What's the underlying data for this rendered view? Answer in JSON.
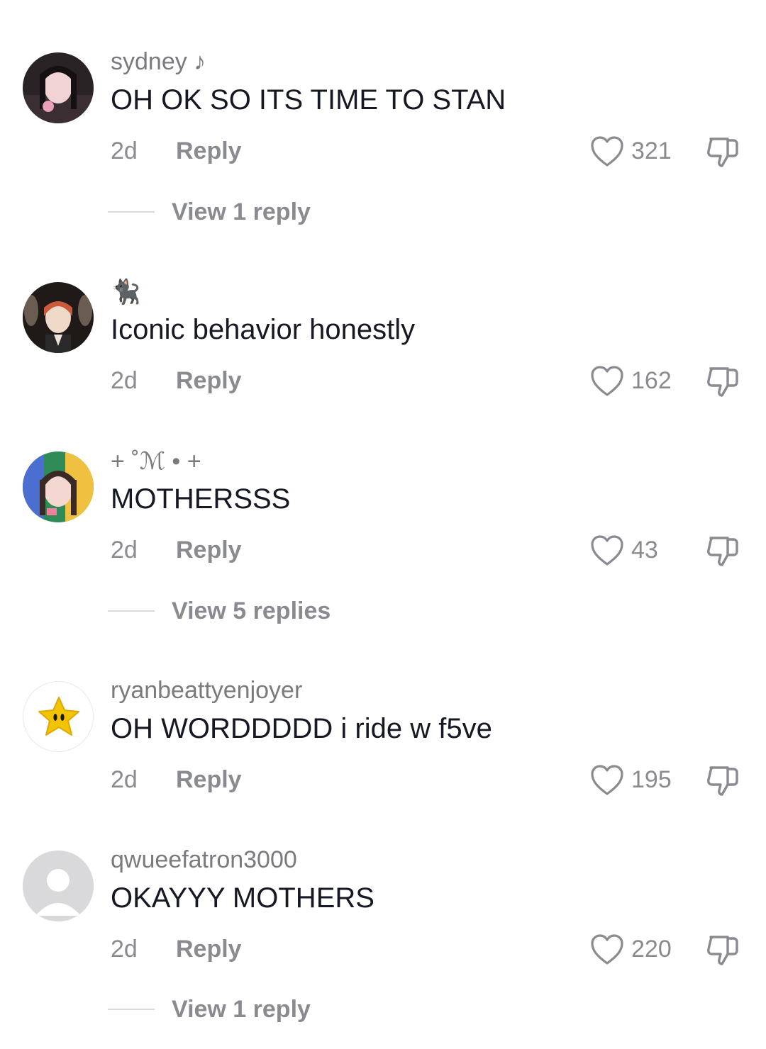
{
  "comments": [
    {
      "username": "sydney ♪",
      "text": "OH OK SO ITS TIME TO STAN",
      "time": "2d",
      "reply_label": "Reply",
      "likes": "321",
      "view_replies": "View 1 reply",
      "avatar_colors": [
        "#2a2326",
        "#e8b6c4",
        "#1b1518"
      ]
    },
    {
      "username": "🐈‍⬛",
      "text": "Iconic behavior honestly",
      "time": "2d",
      "reply_label": "Reply",
      "likes": "162",
      "avatar_colors": [
        "#1f1a17",
        "#c95a3c",
        "#efe3d8"
      ]
    },
    {
      "username": "+ ˚ℳ • +",
      "text": "MOTHERSSS",
      "time": "2d",
      "reply_label": "Reply",
      "likes": "43",
      "view_replies": "View 5 replies",
      "avatar_colors": [
        "#2e8b57",
        "#f4d7d0",
        "#3a2a26"
      ]
    },
    {
      "username": "ryanbeattyenjoyer",
      "text": "OH WORDDDDD i ride w f5ve",
      "time": "2d",
      "reply_label": "Reply",
      "likes": "195",
      "avatar_colors": [
        "#ffffff",
        "#f2c400",
        "#1a1a1a"
      ]
    },
    {
      "username": "qwueefatron3000",
      "text": "OKAYYY MOTHERS",
      "time": "2d",
      "reply_label": "Reply",
      "likes": "220",
      "view_replies": "View 1 reply",
      "avatar_colors": [
        "#d9d9dc",
        "#ffffff",
        "#ffffff"
      ]
    }
  ],
  "colors": {
    "text_primary": "#161823",
    "text_secondary": "#8a8b91",
    "username": "#7a7a7f",
    "divider": "#d9d9dc"
  },
  "icons": {
    "like": "heart-outline-icon",
    "dislike": "thumbs-down-outline-icon"
  }
}
